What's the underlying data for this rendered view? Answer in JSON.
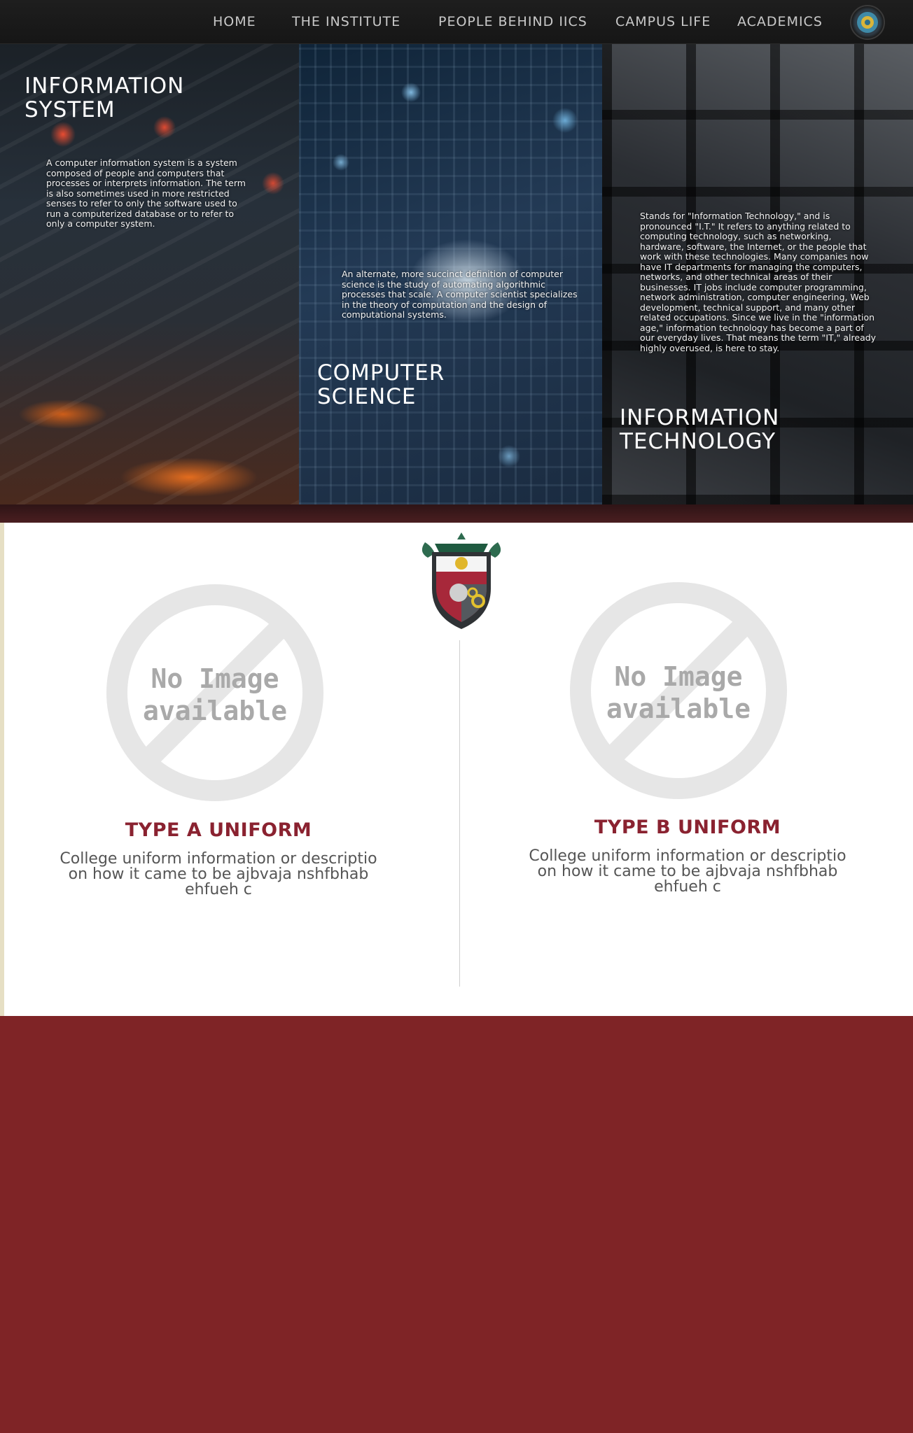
{
  "nav": {
    "items": [
      "HOME",
      "THE INSTITUTE",
      "PEOPLE BEHIND IICS",
      "CAMPUS LIFE",
      "ACADEMICS"
    ]
  },
  "hero": {
    "panels": [
      {
        "title": "INFORMATION SYSTEM",
        "description": "A computer information system is a system composed of people and computers that processes or interprets information. The term is also sometimes used in more restricted senses to refer to only the software used to run a computerized database or to refer to only a computer system."
      },
      {
        "title": "COMPUTER SCIENCE",
        "description": "An alternate, more succinct definition of computer science is the study of automating algorithmic processes that scale. A computer scientist specializes in the theory of computation and the design of computational systems."
      },
      {
        "title": "INFORMATION TECHNOLOGY",
        "description": "Stands for \"Information Technology,\" and is pronounced \"I.T.\" It refers to anything related to computing technology, such as networking, hardware, software, the Internet, or the people that work with these technologies. Many companies now have IT departments for managing the computers, networks, and other technical areas of their businesses. IT jobs include computer programming, network administration, computer engineering, Web development, technical support, and many other related occupations. Since we live in the \"information age,\" information technology has become a part of our everyday lives. That means the term \"IT,\" already highly overused, is here to stay."
      }
    ]
  },
  "uniforms": [
    {
      "image_text": [
        "No Image",
        "available"
      ],
      "title": "TYPE A UNIFORM",
      "description": "College uniform information or descriptio on how it came to be ajbvaja nshfbhab ehfueh c"
    },
    {
      "image_text": [
        "No Image",
        "available"
      ],
      "title": "TYPE B UNIFORM",
      "description": "College uniform information or descriptio on how it came to be ajbvaja nshfbhab ehfueh c"
    }
  ],
  "colors": {
    "nav_bg": "#1b1b1b",
    "maroon": "#7f2426",
    "title_red": "#8a2230"
  }
}
